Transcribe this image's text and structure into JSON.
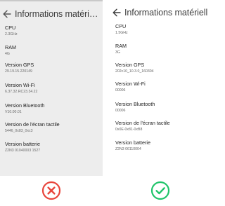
{
  "left": {
    "title": "Informations matériell...",
    "items": [
      {
        "label": "CPU",
        "value": "2.3GHz"
      },
      {
        "label": "RAM",
        "value": "4G"
      },
      {
        "label": "Version GPS",
        "value": "29.19.15.220149"
      },
      {
        "label": "Version Wi-Fi",
        "value": "6.37.32.RC23.34.22"
      },
      {
        "label": "Version Bluetooth",
        "value": "V10.00.01"
      },
      {
        "label": "Version de l'écran tactile",
        "value": "5446_0x83_0xc3"
      },
      {
        "label": "Version batterie",
        "value": "Z2N3 01040003 1527"
      }
    ],
    "status_icon": "error-x-icon",
    "status_color": "#e8453c"
  },
  "right": {
    "title": "Informations matériell",
    "items": [
      {
        "label": "CPU",
        "value": "1.5GHz"
      },
      {
        "label": "RAM",
        "value": "3G"
      },
      {
        "label": "Version GPS",
        "value": "202c10_10.3.0_160304"
      },
      {
        "label": "Version Wi-Fi",
        "value": "00006"
      },
      {
        "label": "Version Bluetooth",
        "value": "00006"
      },
      {
        "label": "Version de l'écran tactile",
        "value": "0x0E-0x81-0xB8"
      },
      {
        "label": "Version batterie",
        "value": "Z2N3 06110004"
      }
    ],
    "status_icon": "check-icon",
    "status_color": "#1fc46a"
  }
}
